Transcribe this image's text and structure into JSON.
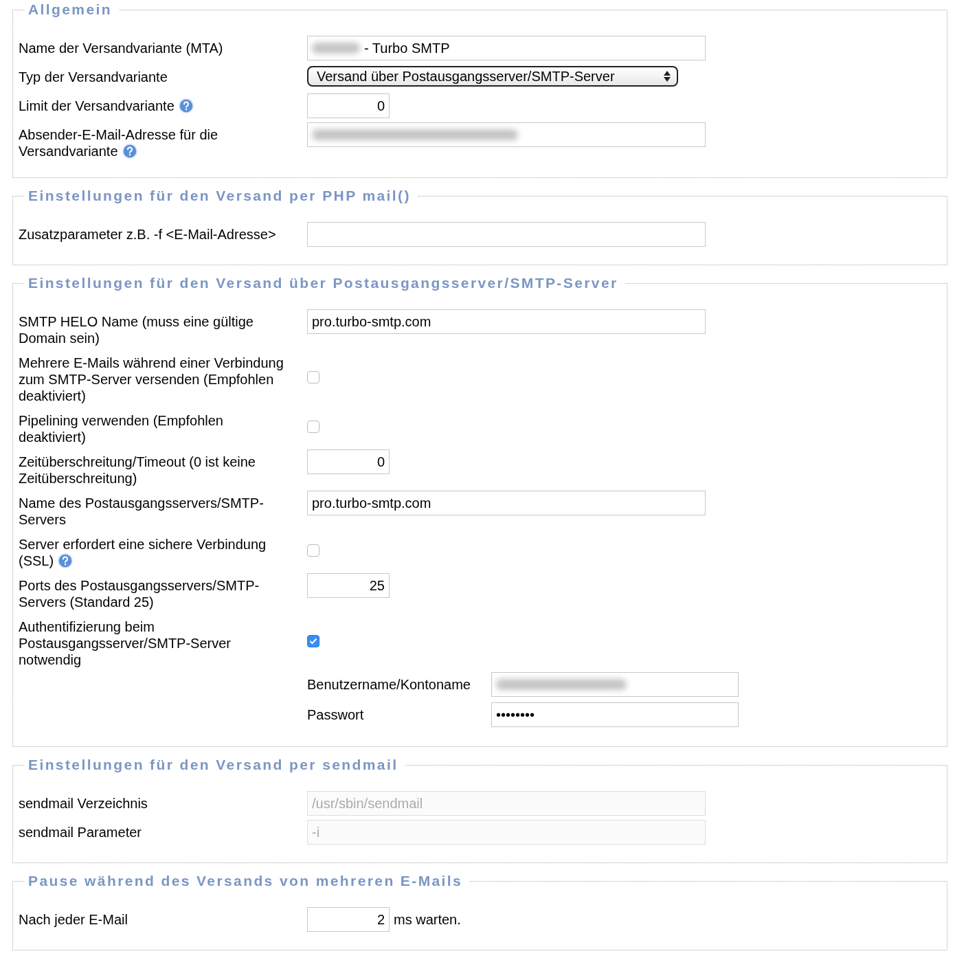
{
  "sections": [
    {
      "legend": "Allgemein",
      "rows": [
        {
          "kind": "text",
          "label": "Name der Versandvariante (MTA)",
          "help": false,
          "value": "- Turbo SMTP",
          "blurred": true
        },
        {
          "kind": "select",
          "label": "Typ der Versandvariante",
          "help": false,
          "value": "Versand über Postausgangsserver/SMTP-Server"
        },
        {
          "kind": "number",
          "label": "Limit der Versandvariante",
          "help": true,
          "value": "0"
        },
        {
          "kind": "text",
          "label": "Absender-E-Mail-Adresse für die Versandvariante",
          "help": true,
          "blurred": true
        }
      ]
    },
    {
      "legend": "Einstellungen für den Versand per PHP mail()",
      "rows": [
        {
          "kind": "text",
          "label": "Zusatzparameter z.B. -f <E-Mail-Adresse>",
          "help": false,
          "blurred": false
        }
      ]
    },
    {
      "legend": "Einstellungen für den Versand über Postausgangsserver/SMTP-Server",
      "rows": [
        {
          "kind": "text",
          "label": "SMTP HELO Name (muss eine gültige Domain sein)",
          "help": false,
          "value": "pro.turbo-smtp.com",
          "blurred": false
        },
        {
          "kind": "checkbox",
          "label": "Mehrere E-Mails während einer Verbindung zum SMTP-Server versenden (Empfohlen deaktiviert)",
          "help": false,
          "checked": false
        },
        {
          "kind": "checkbox",
          "label": "Pipelining verwenden (Empfohlen deaktiviert)",
          "help": false,
          "checked": false
        },
        {
          "kind": "number",
          "label": "Zeitüberschreitung/Timeout (0 ist keine Zeitüberschreitung)",
          "help": false,
          "value": "0"
        },
        {
          "kind": "text",
          "label": "Name des Postausgangsservers/SMTP-Servers",
          "help": false,
          "value": "pro.turbo-smtp.com",
          "blurred": false
        },
        {
          "kind": "checkbox",
          "label": "Server erfordert eine sichere Verbindung (SSL)",
          "help": true,
          "checked": false
        },
        {
          "kind": "number",
          "label": "Ports des Postausgangsservers/SMTP-Servers (Standard 25)",
          "help": false,
          "value": "25"
        },
        {
          "kind": "checkbox",
          "label": "Authentifizierung beim Postausgangsserver/SMTP-Server notwendig",
          "help": false,
          "checked": true
        },
        {
          "kind": "sub",
          "label": "Benutzername/Kontoname",
          "blurred": true
        },
        {
          "kind": "sub",
          "label": "Passwort",
          "value": "••••••••",
          "blurred": false
        }
      ]
    },
    {
      "legend": "Einstellungen für den Versand per sendmail",
      "rows": [
        {
          "kind": "text",
          "label": "sendmail Verzeichnis",
          "help": false,
          "value": "/usr/sbin/sendmail",
          "blurred": false,
          "disabled": true
        },
        {
          "kind": "text",
          "label": "sendmail Parameter",
          "help": false,
          "value": "-i",
          "blurred": false,
          "disabled": true
        }
      ]
    },
    {
      "legend": "Pause während des Versands von mehreren E-Mails",
      "rows": [
        {
          "kind": "number",
          "label": "Nach jeder E-Mail",
          "help": false,
          "value": "2",
          "suffix": "ms warten."
        }
      ]
    }
  ]
}
